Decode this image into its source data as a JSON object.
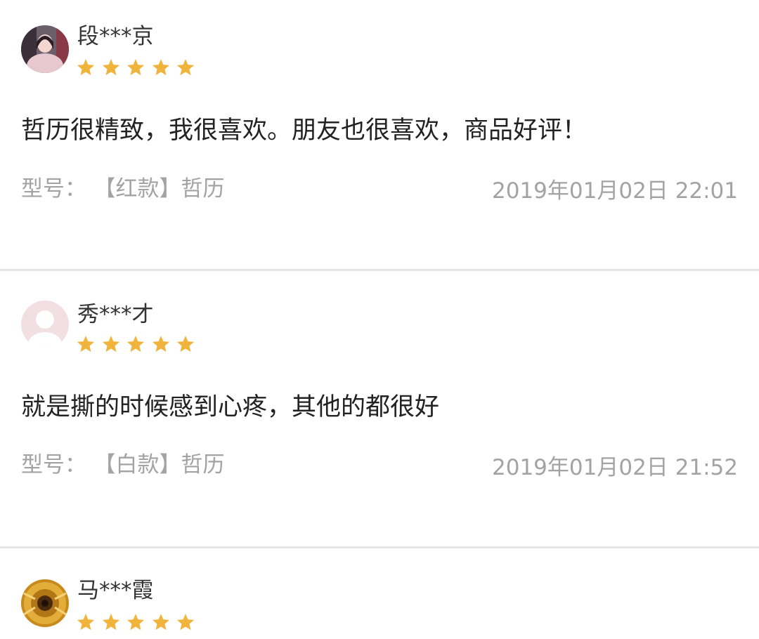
{
  "reviews": [
    {
      "user": "段***京",
      "avatar_icon": "woman-photo-avatar",
      "rating": 5,
      "content": "哲历很精致，我很喜欢。朋友也很喜欢，商品好评！",
      "model_label": "型号：",
      "model_value": "【红款】哲历",
      "date": "2019年01月02日 22:01"
    },
    {
      "user": "秀***才",
      "avatar_icon": "default-user-avatar",
      "rating": 5,
      "content": "就是撕的时候感到心疼，其他的都很好",
      "model_label": "型号：",
      "model_value": "【白款】哲历",
      "date": "2019年01月02日 21:52"
    },
    {
      "user": "马***霞",
      "avatar_icon": "sunflower-photo-avatar",
      "rating": 5
    }
  ],
  "colors": {
    "star": "#f0b43c",
    "text": "#222222",
    "meta": "#a3a3a3",
    "divider": "#e6e6e6"
  }
}
